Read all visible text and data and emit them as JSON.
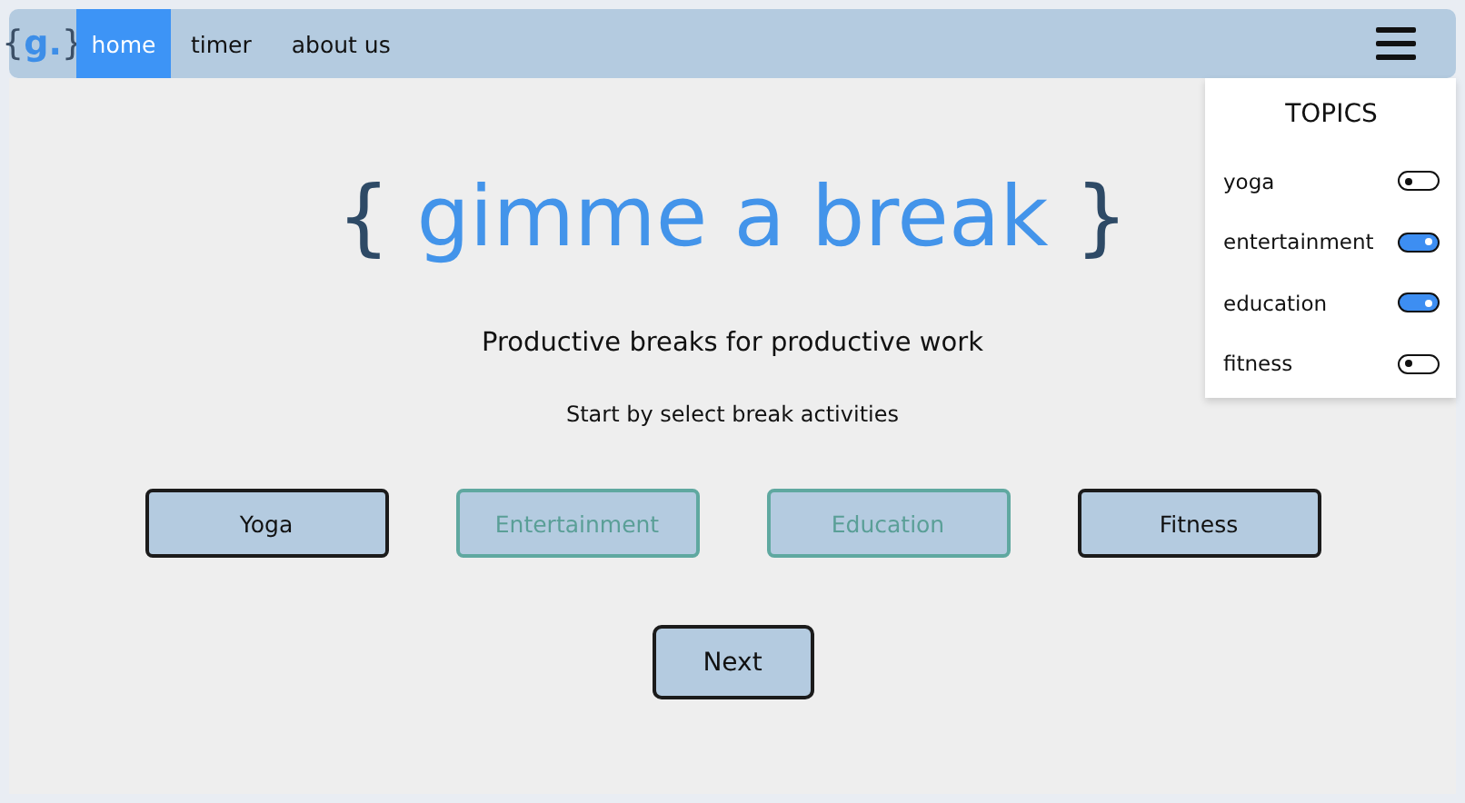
{
  "nav": {
    "logo": {
      "open": "{",
      "mark": "g.",
      "close": "}"
    },
    "links": [
      {
        "label": "home",
        "selected": true
      },
      {
        "label": "timer",
        "selected": false
      },
      {
        "label": "about us",
        "selected": false
      }
    ]
  },
  "topics": {
    "title": "TOPICS",
    "items": [
      {
        "label": "yoga",
        "on": false
      },
      {
        "label": "entertainment",
        "on": true
      },
      {
        "label": "education",
        "on": true
      },
      {
        "label": "fitness",
        "on": false
      }
    ]
  },
  "hero": {
    "open": "{",
    "title": "gimme a break",
    "close": "}"
  },
  "tagline": "Productive breaks for productive work",
  "instruction": "Start by select break activities",
  "activities": [
    {
      "label": "Yoga",
      "selected": false
    },
    {
      "label": "Entertainment",
      "selected": true
    },
    {
      "label": "Education",
      "selected": true
    },
    {
      "label": "Fitness",
      "selected": false
    }
  ],
  "next_button": "Next"
}
